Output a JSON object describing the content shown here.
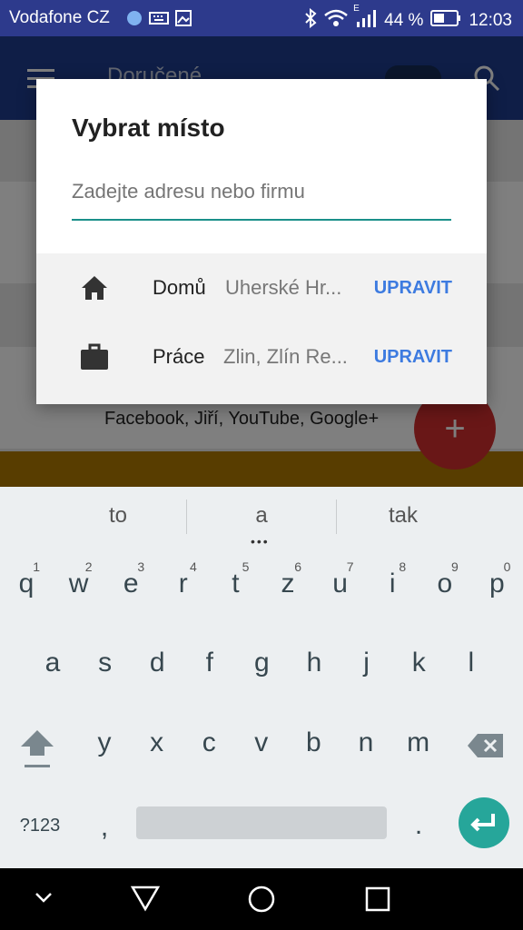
{
  "status_bar": {
    "carrier": "Vodafone CZ",
    "battery": "44 %",
    "time": "12:03",
    "network": "E"
  },
  "app_bar": {
    "title": "Doručené"
  },
  "dialog": {
    "title": "Vybrat místo",
    "search_placeholder": "Zadejte adresu nebo firmu",
    "places": [
      {
        "icon": "home-icon",
        "name": "Domů",
        "address": "Uherské Hr...",
        "action": "UPRAVIT"
      },
      {
        "icon": "briefcase-icon",
        "name": "Práce",
        "address": "Zlin, Zlín Re...",
        "action": "UPRAVIT"
      }
    ]
  },
  "background": {
    "subtext": "Facebook, Jiří, YouTube, Google+"
  },
  "keyboard": {
    "suggestions": [
      "to",
      "a",
      "tak"
    ],
    "row1": [
      {
        "k": "q",
        "h": "1"
      },
      {
        "k": "w",
        "h": "2"
      },
      {
        "k": "e",
        "h": "3"
      },
      {
        "k": "r",
        "h": "4"
      },
      {
        "k": "t",
        "h": "5"
      },
      {
        "k": "z",
        "h": "6"
      },
      {
        "k": "u",
        "h": "7"
      },
      {
        "k": "i",
        "h": "8"
      },
      {
        "k": "o",
        "h": "9"
      },
      {
        "k": "p",
        "h": "0"
      }
    ],
    "row2": [
      "a",
      "s",
      "d",
      "f",
      "g",
      "h",
      "j",
      "k",
      "l"
    ],
    "row3": [
      "y",
      "x",
      "c",
      "v",
      "b",
      "n",
      "m"
    ],
    "symbols_label": "?123",
    "comma": ",",
    "period": "."
  },
  "colors": {
    "accent": "#1a8f8a",
    "action": "#3d7be0",
    "enter_key": "#26a69a",
    "fab": "#d32f2f"
  }
}
